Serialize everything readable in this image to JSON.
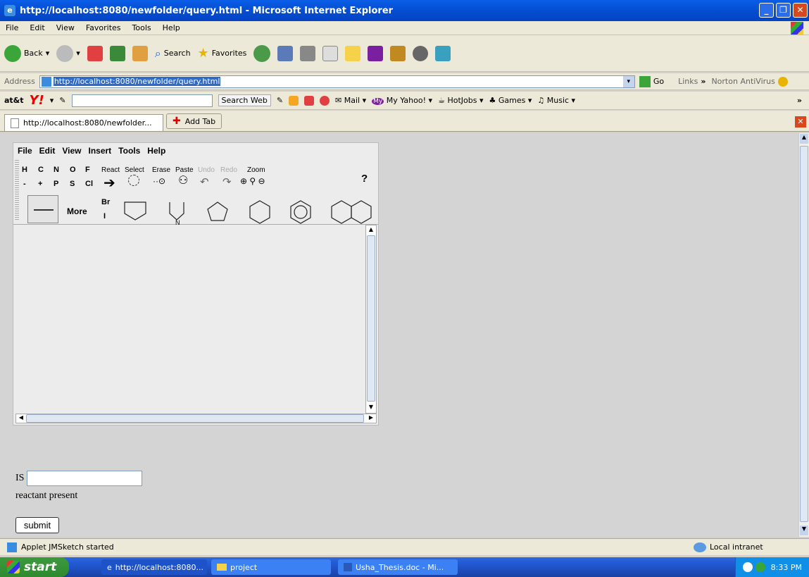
{
  "window": {
    "title": "http://localhost:8080/newfolder/query.html - Microsoft Internet Explorer",
    "minimize": "_",
    "maximize": "❐",
    "close": "✕"
  },
  "menu": [
    "File",
    "Edit",
    "View",
    "Favorites",
    "Tools",
    "Help"
  ],
  "toolbar": {
    "back": "Back",
    "search": "Search",
    "favorites": "Favorites"
  },
  "address": {
    "label": "Address",
    "url": "http://localhost:8080/newfolder/query.html",
    "go": "Go",
    "links": "Links",
    "norton": "Norton AntiVirus"
  },
  "yahoo": {
    "att": "at&t",
    "yahoo": "Y!",
    "search_web": "Search Web",
    "mail": "Mail",
    "my_yahoo": "My Yahoo!",
    "hotjobs": "HotJobs",
    "games": "Games",
    "music": "Music"
  },
  "tabs": {
    "active": "http://localhost:8080/newfolder...",
    "add": "Add Tab"
  },
  "applet": {
    "menu": [
      "File",
      "Edit",
      "View",
      "Insert",
      "Tools",
      "Help"
    ],
    "atoms_row1": [
      "H",
      "C",
      "N",
      "O",
      "F"
    ],
    "atoms_row2": [
      "-",
      "+",
      "P",
      "S",
      "Cl"
    ],
    "atoms_col": [
      "Br",
      "I"
    ],
    "tool_labels": [
      "React",
      "Select",
      "Erase",
      "Paste",
      "Undo",
      "Redo",
      "Zoom"
    ],
    "help": "?",
    "more": "More",
    "ring_n": "N"
  },
  "form": {
    "is_label": "IS",
    "reactant_text": "reactant present",
    "submit": "submit"
  },
  "status": {
    "text": "Applet JMSketch started",
    "zone": "Local intranet"
  },
  "taskbar": {
    "start": "start",
    "items": [
      "http://localhost:8080...",
      "project",
      "Usha_Thesis.doc - Mi..."
    ],
    "time": "8:33 PM"
  }
}
